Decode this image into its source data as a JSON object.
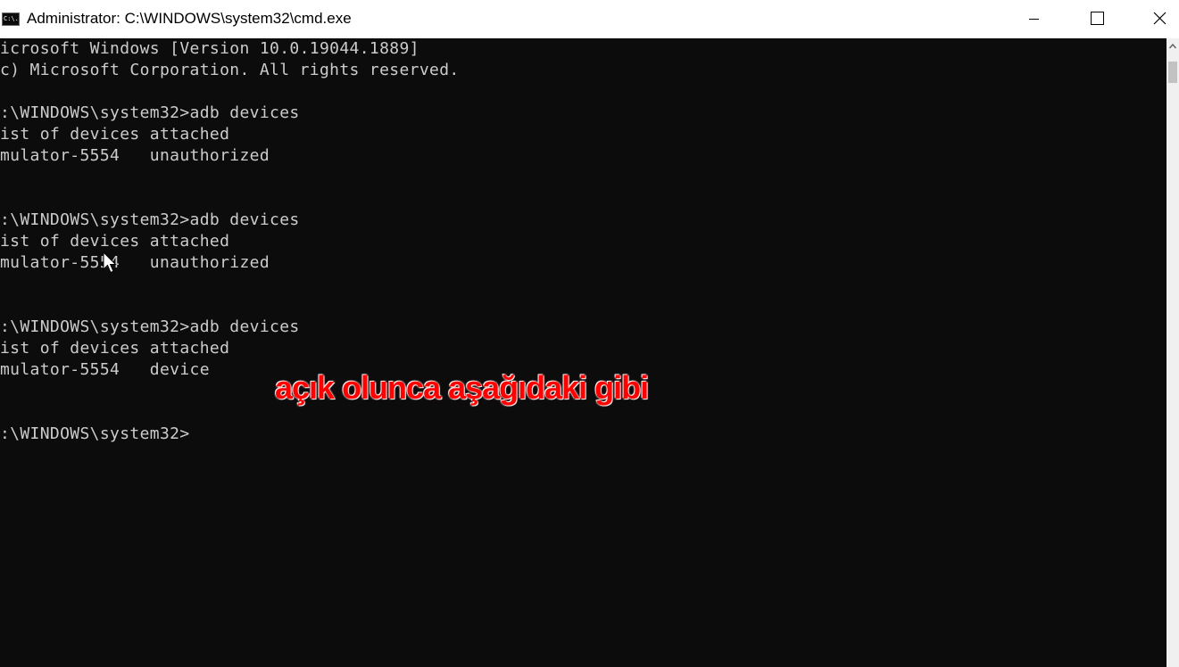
{
  "window": {
    "title": "Administrator: C:\\WINDOWS\\system32\\cmd.exe",
    "icon_text": "C:\\."
  },
  "console": {
    "lines": [
      "icrosoft Windows [Version 10.0.19044.1889]",
      "c) Microsoft Corporation. All rights reserved.",
      ":\\WINDOWS\\system32>adb devices",
      "ist of devices attached",
      "mulator-5554   unauthorized",
      ":\\WINDOWS\\system32>adb devices",
      "ist of devices attached",
      "mulator-5554   unauthorized",
      ":\\WINDOWS\\system32>adb devices",
      "ist of devices attached",
      "mulator-5554   device",
      ":\\WINDOWS\\system32>"
    ],
    "annotation": "açık olunca aşağıdaki gibi"
  },
  "colors": {
    "console_bg": "#0c0c0c",
    "console_text": "#cccccc",
    "annotation": "#ff0000"
  },
  "icons": [
    "cmd-app-icon",
    "minimize-icon",
    "maximize-icon",
    "close-icon",
    "mouse-pointer-icon",
    "scroll-up-arrow-icon"
  ]
}
